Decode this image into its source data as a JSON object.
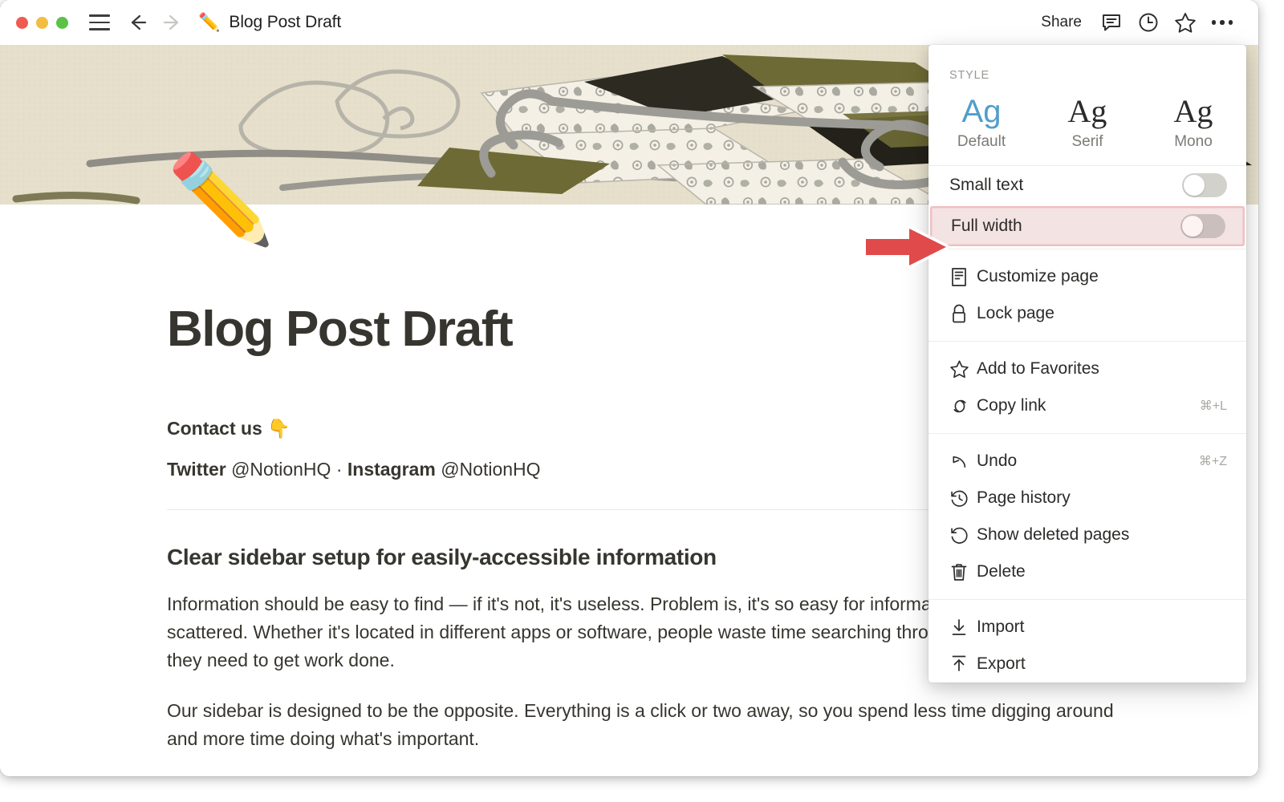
{
  "window": {
    "traffic_lights": [
      "close",
      "minimize",
      "maximize"
    ],
    "colors": {
      "close": "#f05b51",
      "minimize": "#f2bd42",
      "maximize": "#5cc247"
    }
  },
  "titlebar": {
    "menu_icon": "hamburger-icon",
    "back_icon": "arrow-left-icon",
    "forward_icon": "arrow-right-icon",
    "page_emoji": "✏️",
    "title": "Blog Post Draft",
    "share_label": "Share",
    "comment_icon": "comment-icon",
    "history_icon": "clock-icon",
    "favorite_icon": "star-icon",
    "more_icon": "ellipsis-icon"
  },
  "page": {
    "icon_emoji": "✏️",
    "title": "Blog Post Draft",
    "contact_heading": "Contact us 👇",
    "social": {
      "twitter_label": "Twitter",
      "twitter_handle": "@NotionHQ",
      "separator": "·",
      "instagram_label": "Instagram",
      "instagram_handle": "@NotionHQ"
    },
    "section_heading": "Clear sidebar setup for easily-accessible information",
    "paragraph_1": "Information should be easy to find — if it's not, it's useless. Problem is, it's so easy for information to become scattered. Whether it's located in different apps or software, people waste time searching through it all to find what they need to get work done.",
    "paragraph_2": "Our sidebar is designed to be the opposite. Everything is a click or two away, so you spend less time digging around and more time doing what's important."
  },
  "menu": {
    "section_label": "STYLE",
    "style_options": [
      {
        "sample": "Ag",
        "label": "Default",
        "selected": true
      },
      {
        "sample": "Ag",
        "label": "Serif",
        "selected": false
      },
      {
        "sample": "Ag",
        "label": "Mono",
        "selected": false
      }
    ],
    "toggles": [
      {
        "label": "Small text",
        "on": false,
        "highlighted": false
      },
      {
        "label": "Full width",
        "on": false,
        "highlighted": true
      }
    ],
    "groups": [
      {
        "items": [
          {
            "icon": "page-icon",
            "label": "Customize page",
            "shortcut": ""
          },
          {
            "icon": "lock-icon",
            "label": "Lock page",
            "shortcut": ""
          }
        ]
      },
      {
        "items": [
          {
            "icon": "star-icon",
            "label": "Add to Favorites",
            "shortcut": ""
          },
          {
            "icon": "link-icon",
            "label": "Copy link",
            "shortcut": "⌘+L"
          }
        ]
      },
      {
        "items": [
          {
            "icon": "undo-icon",
            "label": "Undo",
            "shortcut": "⌘+Z"
          },
          {
            "icon": "history-icon",
            "label": "Page history",
            "shortcut": ""
          },
          {
            "icon": "restore-icon",
            "label": "Show deleted pages",
            "shortcut": ""
          },
          {
            "icon": "trash-icon",
            "label": "Delete",
            "shortcut": ""
          }
        ]
      },
      {
        "items": [
          {
            "icon": "import-icon",
            "label": "Import",
            "shortcut": ""
          },
          {
            "icon": "export-icon",
            "label": "Export",
            "shortcut": ""
          }
        ]
      }
    ]
  },
  "annotation": {
    "arrow_icon": "red-arrow-right-icon",
    "arrow_color": "#e04a4a",
    "highlight_border_color": "#f0c0c0",
    "highlight_fill_color": "#f4e3e3",
    "target_label": "Full width"
  },
  "accent_color": "#529ecb"
}
